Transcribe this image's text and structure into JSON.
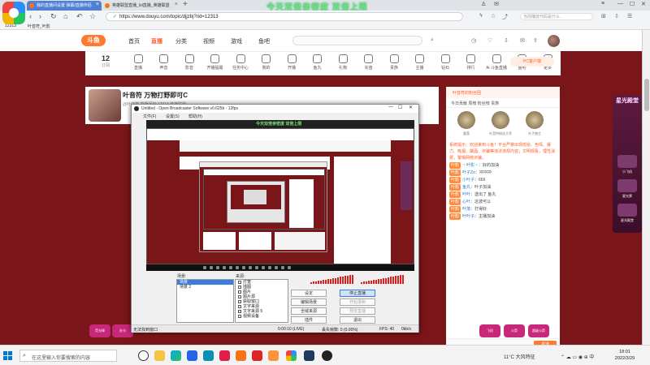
{
  "browser": {
    "tabs": [
      {
        "label": "我的直播间设置 弹幕/直播伴侣",
        "active": true
      },
      {
        "label": "英雄联盟直播_lol直播_英雄联盟",
        "active": false
      }
    ],
    "overlay_title": "今天双倍亲密度  双倍上限",
    "url": "https://www.douyu.com/topic/djjzbj?rid=12313",
    "search_hint": "当前播放代码是什么",
    "bookmarks": [
      "12313",
      "叶音符_叶影"
    ]
  },
  "douyu": {
    "logo": "斗鱼",
    "nav": [
      "首页",
      "直播",
      "分类",
      "视频",
      "游戏",
      "鱼吧"
    ],
    "active_nav": "直播",
    "follow": {
      "count": "12",
      "label": "订阅"
    },
    "categories": [
      "直播",
      "声音",
      "影音",
      "开播提醒",
      "任务中心",
      "我的",
      "开播",
      "鱼丸",
      "礼物",
      "充值",
      "贵族",
      "主播",
      "钻石",
      "排行",
      "Ai 斗鱼直播",
      "鱼吧",
      "更多"
    ],
    "room_title": "叶音符 万物打野即可C",
    "room_meta": "@叶音符  直播间ID 12313  英雄联盟",
    "pc_badge": "PC客户端",
    "right_header": "叶音符的粉丝团",
    "right_tabs": "今日贡献   周榜   粉丝榜   贵族",
    "ranks": [
      "鹿茸",
      "叶音符粉丝大军",
      "叶子旗主"
    ],
    "chat_sys": "系统提示：欢迎来到斗鱼！平台严禁出现低俗、色情、暴力、吸烟、酗酒、诈骗等违法违规内容；文明观看，理性消费，警惕网络诈骗。",
    "chat": [
      {
        "badge": "叶影",
        "nick": "丶叶影丶",
        "msg": "：好的加油"
      },
      {
        "badge": "叶影",
        "nick": "叶子Ze",
        "msg": "：冲冲冲"
      },
      {
        "badge": "叶影",
        "nick": "小叶子",
        "msg": "：666"
      },
      {
        "badge": "叶影",
        "nick": "鱼丸",
        "msg": "：叶子加油"
      },
      {
        "badge": "叶影",
        "nick": "叶叶",
        "msg": "：送出了 鱼丸"
      },
      {
        "badge": "叶影",
        "nick": "心叶",
        "msg": "：这波可以"
      },
      {
        "badge": "叶影",
        "nick": "叶落",
        "msg": "：打得好"
      },
      {
        "badge": "叶影",
        "nick": "叶叶子",
        "msg": "：主播加油"
      }
    ],
    "send_label": "发送",
    "side_ad": {
      "title": "星光殿堂",
      "items": [
        "小飞机",
        "星光票",
        "星光殿堂"
      ]
    },
    "gifts": [
      "荧光棒",
      "办卡",
      "飞机",
      "火箭",
      "超级火箭"
    ]
  },
  "obs": {
    "title": "Untitled - Open Broadcaster Software v0.625b - 12fps",
    "menu": [
      "文件(F)",
      "设置(S)",
      "帮助(H)"
    ],
    "overlay_title": "今天双倍亲密度  双倍上限",
    "scenes_label": "场景:",
    "scenes": [
      "场景",
      "场景 2"
    ],
    "sources_label": "来源:",
    "sources": [
      "灯笼",
      "插图",
      "图片",
      "图片源",
      "获取窗口",
      "文字来源",
      "文字来源 5",
      "视频设备"
    ],
    "buttons": {
      "settings": "设定",
      "stop_stream": "停止直播",
      "edit_scene": "编辑场景",
      "start_recording": "开始录制",
      "global_sources": "全域来源",
      "preview": "预览直播",
      "plugins": "插件",
      "exit": "退出"
    },
    "status": {
      "left": "无法找到窗口",
      "time": "0:00:10 (LIVE)",
      "dropped": "丢失帧数: 0 (0.00%)",
      "fps": "FPS: 40",
      "bitrate": "0kb/s"
    }
  },
  "taskbar": {
    "search_placeholder": "在这里输入你要搜索的内容",
    "weather": "11°C 大风特征",
    "time": "18:01",
    "date": "2022/3/29"
  }
}
